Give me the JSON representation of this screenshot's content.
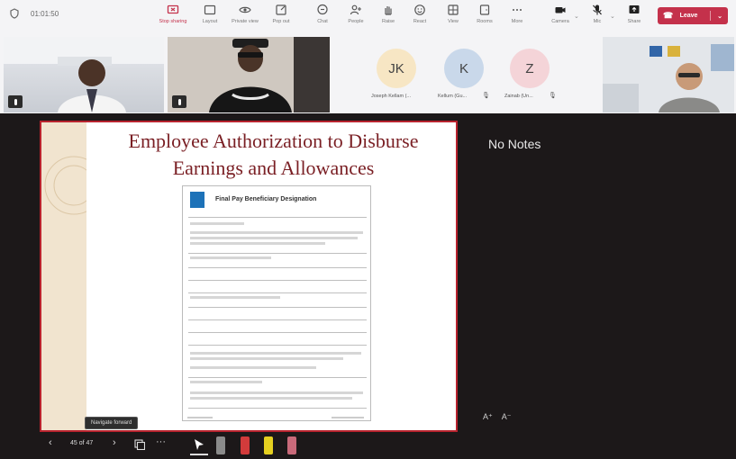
{
  "toolbar": {
    "timer": "01:01:50",
    "buttons": [
      {
        "label": "Stop sharing",
        "icon": "stop-sharing-icon",
        "active": true
      },
      {
        "label": "Layout",
        "icon": "layout-icon"
      },
      {
        "label": "Private view",
        "icon": "private-view-icon"
      },
      {
        "label": "Pop out",
        "icon": "pop-out-icon"
      },
      {
        "label": "Chat",
        "icon": "chat-icon"
      },
      {
        "label": "People",
        "icon": "people-icon"
      },
      {
        "label": "Raise",
        "icon": "raise-hand-icon"
      },
      {
        "label": "React",
        "icon": "react-icon"
      },
      {
        "label": "View",
        "icon": "view-icon"
      },
      {
        "label": "Rooms",
        "icon": "rooms-icon"
      },
      {
        "label": "More",
        "icon": "more-icon"
      },
      {
        "label": "Camera",
        "icon": "camera-icon"
      },
      {
        "label": "Mic",
        "icon": "mic-icon"
      },
      {
        "label": "Share",
        "icon": "share-icon"
      }
    ],
    "leave_label": "Leave",
    "leave_color": "#c4314b"
  },
  "participants": {
    "avatars": [
      {
        "initials": "JK",
        "name": "Joseph Kellam (...",
        "color": "#f7e6c4"
      },
      {
        "initials": "K",
        "name": "Kellum (Gu...",
        "color": "#c9d8ea"
      },
      {
        "initials": "Z",
        "name": "Zainab (Un...",
        "color": "#f4d4d8"
      }
    ]
  },
  "slide": {
    "title_line1": "Employee Authorization to Disburse",
    "title_line2": "Earnings and Allowances",
    "doc_heading": "Final Pay Beneficiary Designation",
    "title_color": "#7a1f24",
    "border_color": "#b8232e"
  },
  "tooltip": "Navigate forward",
  "notes": {
    "text": "No Notes",
    "font_increase": "A⁺",
    "font_decrease": "A⁻"
  },
  "controls": {
    "slide_counter": "45 of 47"
  }
}
